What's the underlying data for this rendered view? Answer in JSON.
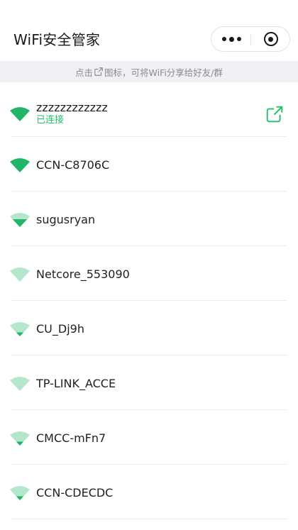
{
  "header": {
    "title": "WiFi安全管家"
  },
  "icons": {
    "more": "more-dots-icon",
    "close": "target-close-icon",
    "share": "share-icon",
    "wifi": "wifi-signal-icon"
  },
  "hint": {
    "prefix": "点击",
    "suffix": "图标，可将WiFi分享给好友/群"
  },
  "colors": {
    "accent": "#22c06a",
    "wifi_strong": "#21b667",
    "wifi_weak": "#b4e6cb"
  },
  "networks": [
    {
      "ssid": "zzzzzzzzzzzz",
      "status": "已连接",
      "signal": 4
    },
    {
      "ssid": "CCN-C8706C",
      "signal": 4
    },
    {
      "ssid": "sugusryan",
      "signal": 2
    },
    {
      "ssid": "Netcore_553090",
      "signal": 0
    },
    {
      "ssid": "CU_Dj9h",
      "signal": 1
    },
    {
      "ssid": "TP-LINK_ACCE",
      "signal": 0
    },
    {
      "ssid": "CMCC-mFn7",
      "signal": 1
    },
    {
      "ssid": "CCN-CDECDC",
      "signal": 1
    }
  ]
}
